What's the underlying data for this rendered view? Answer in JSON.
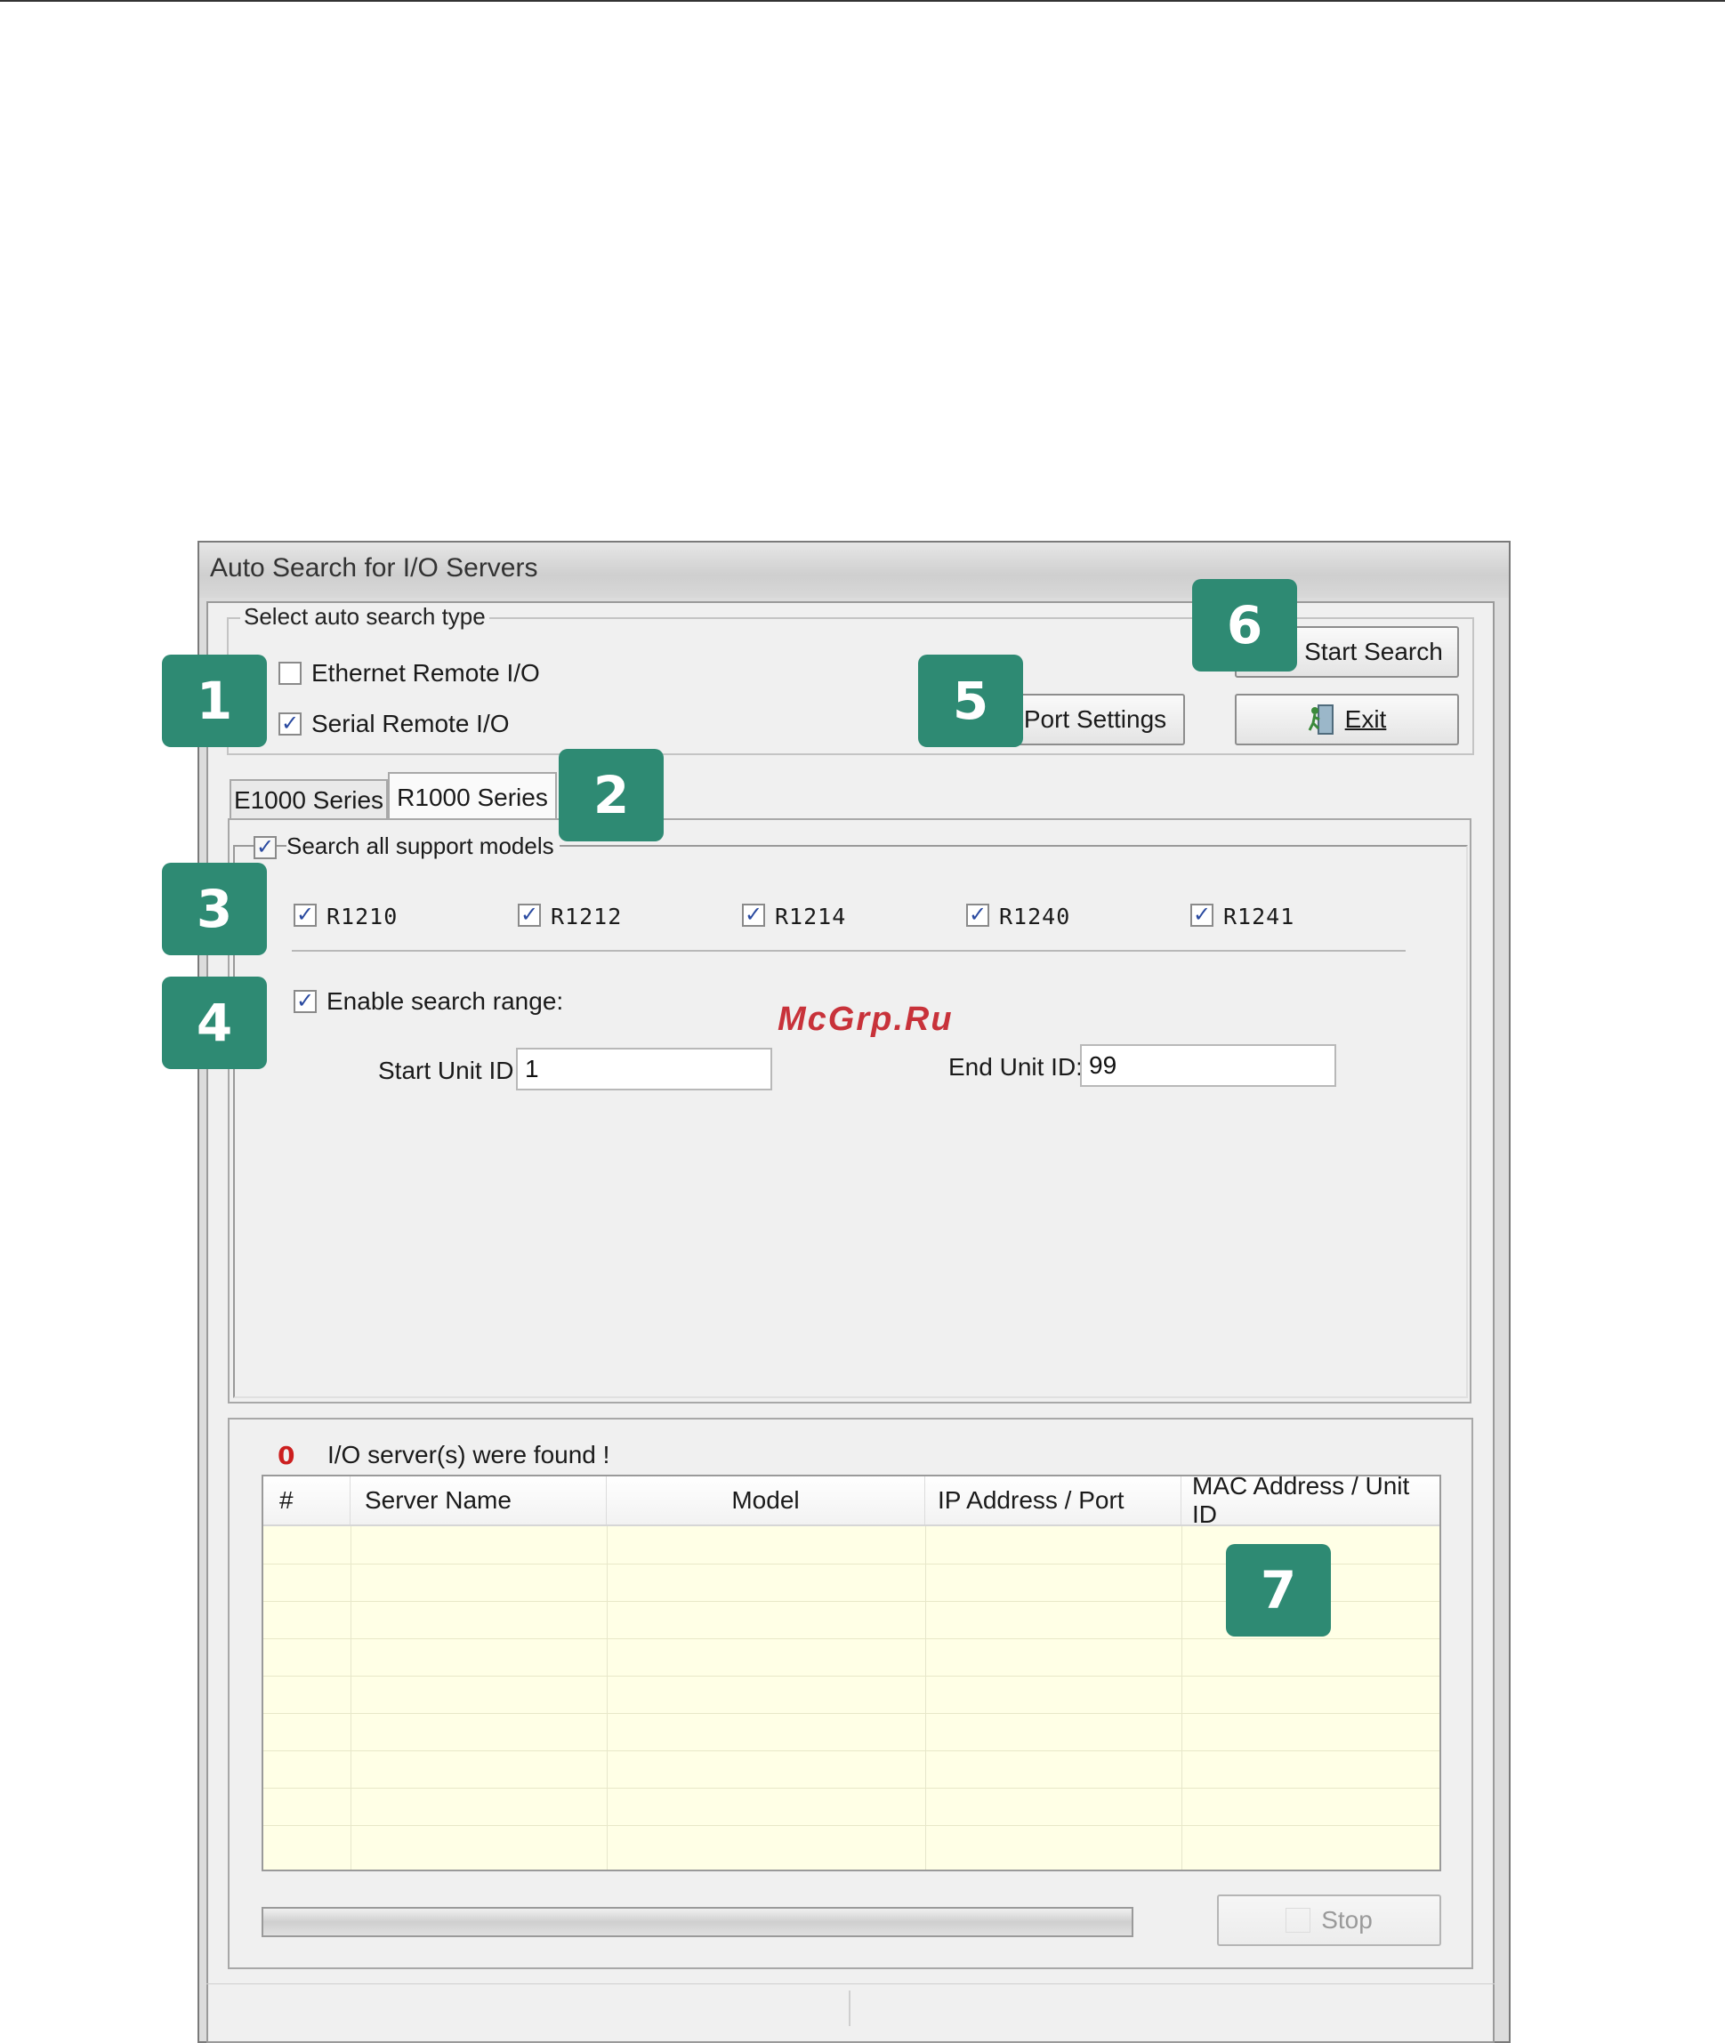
{
  "window": {
    "title": "Auto Search for I/O Servers"
  },
  "search_type": {
    "legend": "Select auto search type",
    "ethernet": {
      "label": "Ethernet Remote I/O",
      "checked": false
    },
    "serial": {
      "label": "Serial Remote I/O",
      "checked": true
    }
  },
  "buttons": {
    "start_search": "Start Search",
    "port_settings": "Port Settings",
    "exit": "Exit",
    "stop": "Stop"
  },
  "tabs": [
    {
      "label": "E1000 Series",
      "active": false
    },
    {
      "label": "R1000 Series",
      "active": true
    }
  ],
  "models": {
    "search_all_label": "Search all support models",
    "items": [
      {
        "label": "R1210",
        "checked": true
      },
      {
        "label": "R1212",
        "checked": true
      },
      {
        "label": "R1214",
        "checked": true
      },
      {
        "label": "R1240",
        "checked": true
      },
      {
        "label": "R1241",
        "checked": true
      }
    ]
  },
  "range": {
    "enable_label": "Enable search range:",
    "start_label": "Start Unit ID:",
    "start_value": "1",
    "end_label": "End Unit ID:",
    "end_value": "99"
  },
  "results": {
    "count": "0",
    "found_text": "I/O server(s) were found !",
    "columns": [
      "#",
      "Server Name",
      "Model",
      "IP Address / Port",
      "MAC Address / Unit ID"
    ]
  },
  "badges": [
    "1",
    "2",
    "3",
    "4",
    "5",
    "6",
    "7"
  ],
  "watermark": "McGrp.Ru",
  "icons": {
    "exit": "exit-door-icon",
    "check": "checkmark-icon"
  },
  "colors": {
    "badge": "#2e8a73",
    "count": "#cc1f1f",
    "watermark": "#c8323a",
    "table_bg": "#ffffe6"
  }
}
